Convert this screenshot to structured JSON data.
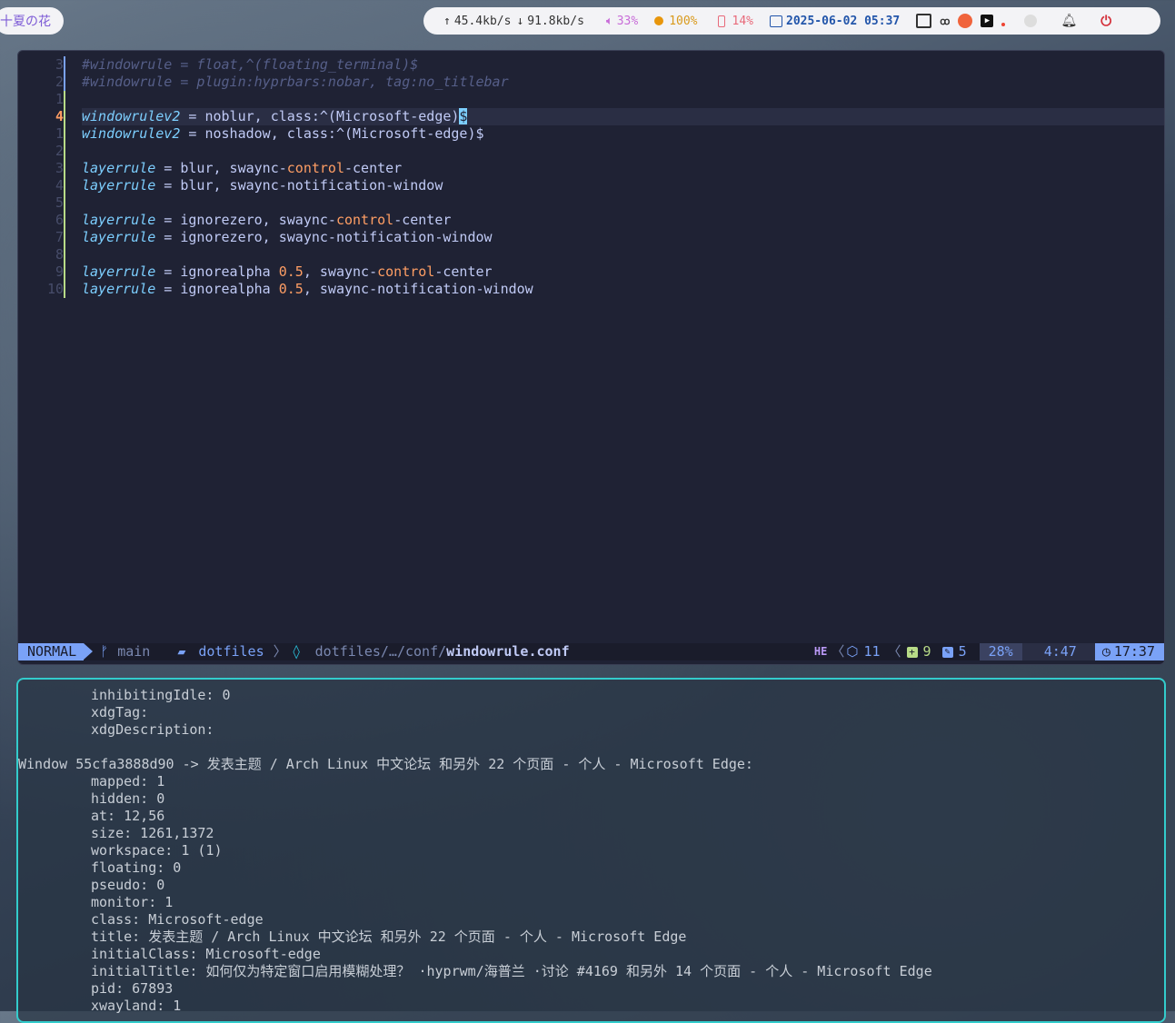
{
  "topbar": {
    "workspace_label": "十夏の花",
    "net_up": "45.4kb/s",
    "net_down": "91.8kb/s",
    "volume": "33%",
    "battery_dot": "100%",
    "battery": "14%",
    "datetime": "2025-06-02 05:37",
    "tray_icons": [
      "window-icon",
      "link-icon",
      "cat-icon",
      "play-icon",
      "red-dot-icon",
      "circle-icon"
    ],
    "bell_icon": "bell-icon",
    "power_icon": "power-icon"
  },
  "editor": {
    "gutter": [
      "3",
      "2",
      "1",
      "4",
      "1",
      "2",
      "3",
      "4",
      "5",
      "6",
      "7",
      "8",
      "9",
      "10"
    ],
    "lines": [
      {
        "t": "comment",
        "text": "#windowrule = float,^(floating_terminal)$"
      },
      {
        "t": "comment",
        "text": "#windowrule = plugin:hyprbars:nobar, tag:no_titlebar"
      },
      {
        "t": "blank",
        "text": ""
      },
      {
        "t": "rule",
        "kw": "windowrulev2",
        "rest": " = noblur, class:^(Microsoft-edge)",
        "cursor": "$"
      },
      {
        "t": "rule",
        "kw": "windowrulev2",
        "rest": " = noshadow, class:^(Microsoft-edge)$"
      },
      {
        "t": "blank",
        "text": ""
      },
      {
        "t": "layer",
        "kw": "layerrule",
        "pre": " = blur, swaync-",
        "hl": "control",
        "post": "-center"
      },
      {
        "t": "rule",
        "kw": "layerrule",
        "rest": " = blur, swaync-notification-window"
      },
      {
        "t": "blank",
        "text": ""
      },
      {
        "t": "layer",
        "kw": "layerrule",
        "pre": " = ignorezero, swaync-",
        "hl": "control",
        "post": "-center"
      },
      {
        "t": "rule",
        "kw": "layerrule",
        "rest": " = ignorezero, swaync-notification-window"
      },
      {
        "t": "blank",
        "text": ""
      },
      {
        "t": "alpha",
        "kw": "layerrule",
        "pre": " = ignorealpha ",
        "num": "0.5",
        "mid": ", swaync-",
        "hl": "control",
        "post": "-center"
      },
      {
        "t": "alpha",
        "kw": "layerrule",
        "pre": " = ignorealpha ",
        "num": "0.5",
        "mid": ", swaync-notification-window",
        "hl": "",
        "post": ""
      }
    ]
  },
  "statusline": {
    "mode": "NORMAL",
    "branch": "main",
    "project": "dotfiles",
    "path_prefix": "dotfiles/…/conf/",
    "filename": "windowrule.conf",
    "lsp_count": "11",
    "added": "9",
    "changed": "5",
    "percent": "28%",
    "location": "4:47",
    "clock": "17:37"
  },
  "terminal": {
    "lines": [
      {
        "indent": true,
        "text": "inhibitingIdle: 0"
      },
      {
        "indent": true,
        "text": "xdgTag:"
      },
      {
        "indent": true,
        "text": "xdgDescription:"
      },
      {
        "indent": false,
        "text": ""
      },
      {
        "indent": false,
        "text": "Window 55cfa3888d90 -> 发表主题 / Arch Linux 中文论坛 和另外 22 个页面 - 个人 - Microsoft Edge:"
      },
      {
        "indent": true,
        "text": "mapped: 1"
      },
      {
        "indent": true,
        "text": "hidden: 0"
      },
      {
        "indent": true,
        "text": "at: 12,56"
      },
      {
        "indent": true,
        "text": "size: 1261,1372"
      },
      {
        "indent": true,
        "text": "workspace: 1 (1)"
      },
      {
        "indent": true,
        "text": "floating: 0"
      },
      {
        "indent": true,
        "text": "pseudo: 0"
      },
      {
        "indent": true,
        "text": "monitor: 1"
      },
      {
        "indent": true,
        "text": "class: Microsoft-edge"
      },
      {
        "indent": true,
        "text": "title: 发表主题 / Arch Linux 中文论坛 和另外 22 个页面 - 个人 - Microsoft Edge"
      },
      {
        "indent": true,
        "text": "initialClass: Microsoft-edge"
      },
      {
        "indent": true,
        "text": "initialTitle: 如何仅为特定窗口启用模糊处理？ ·hyprwm/海普兰 ·讨论 #4169 和另外 14 个页面 - 个人 - Microsoft Edge"
      },
      {
        "indent": true,
        "text": "pid: 67893"
      },
      {
        "indent": true,
        "text": "xwayland: 1"
      }
    ]
  },
  "colors": {
    "accent": "#7aa2f7",
    "keyword": "#7dcfff",
    "orange": "#ff9e64",
    "terminal_border": "#33cccc",
    "editor_bg": "#1f2234"
  }
}
